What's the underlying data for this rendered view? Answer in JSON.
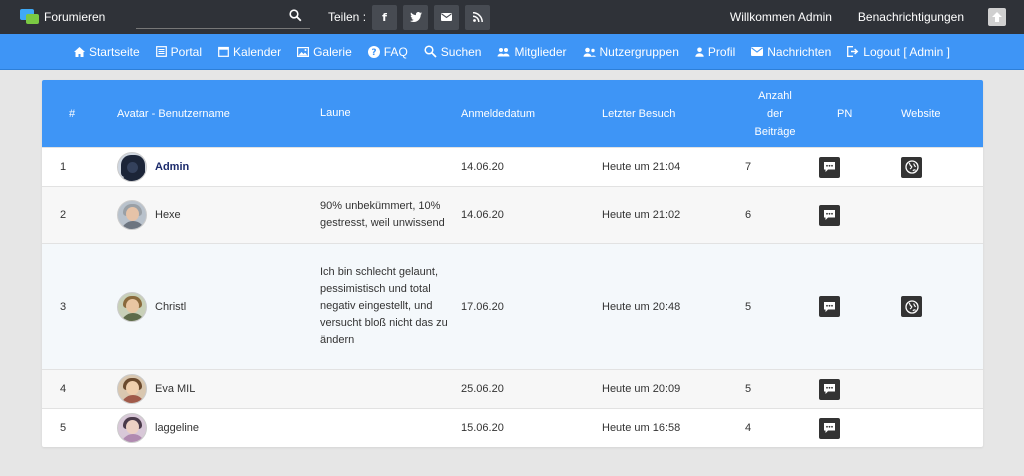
{
  "topbar": {
    "logo_text": "Forumieren",
    "search_placeholder": "",
    "share_label": "Teilen :",
    "share_buttons": [
      "facebook-icon",
      "twitter-icon",
      "mail-icon",
      "rss-icon"
    ],
    "welcome": "Willkommen Admin",
    "notifications": "Benachrichtigungen"
  },
  "nav": [
    {
      "label": "Startseite",
      "icon": "home-icon"
    },
    {
      "label": "Portal",
      "icon": "portal-icon"
    },
    {
      "label": "Kalender",
      "icon": "calendar-icon"
    },
    {
      "label": "Galerie",
      "icon": "gallery-icon"
    },
    {
      "label": "FAQ",
      "icon": "faq-icon"
    },
    {
      "label": "Suchen",
      "icon": "search-icon"
    },
    {
      "label": "Mitglieder",
      "icon": "members-icon"
    },
    {
      "label": "Nutzergruppen",
      "icon": "usergroups-icon"
    },
    {
      "label": "Profil",
      "icon": "profile-icon"
    },
    {
      "label": "Nachrichten",
      "icon": "messages-icon"
    },
    {
      "label": "Logout [ Admin ]",
      "icon": "logout-icon"
    }
  ],
  "table": {
    "headers": {
      "num": "#",
      "user": "Avatar - Benutzername",
      "mood": "Laune",
      "registered": "Anmeldedatum",
      "last_visit": "Letzter Besuch",
      "posts_line1": "Anzahl",
      "posts_line2": "der",
      "posts_line3": "Beiträge",
      "pm": "PN",
      "website": "Website"
    },
    "rows": [
      {
        "num": "1",
        "name": "Admin",
        "mood": "",
        "registered": "14.06.20",
        "last_visit": "Heute um 21:04",
        "posts": "7",
        "has_website": true
      },
      {
        "num": "2",
        "name": "Hexe",
        "mood": "90% unbekümmert, 10% gestresst, weil unwissend",
        "registered": "14.06.20",
        "last_visit": "Heute um 21:02",
        "posts": "6",
        "has_website": false
      },
      {
        "num": "3",
        "name": "Christl",
        "mood": "Ich bin schlecht gelaunt, pessimistisch und total negativ eingestellt, und versucht bloß nicht das zu ändern",
        "registered": "17.06.20",
        "last_visit": "Heute um 20:48",
        "posts": "5",
        "has_website": true
      },
      {
        "num": "4",
        "name": "Eva MIL",
        "mood": "",
        "registered": "25.06.20",
        "last_visit": "Heute um 20:09",
        "posts": "5",
        "has_website": false
      },
      {
        "num": "5",
        "name": "laggeline",
        "mood": "",
        "registered": "15.06.20",
        "last_visit": "Heute um 16:58",
        "posts": "4",
        "has_website": false
      }
    ]
  },
  "colors": {
    "topbar": "#2f3238",
    "accent": "#3e95f6",
    "admin_name": "#1b2a6b"
  }
}
